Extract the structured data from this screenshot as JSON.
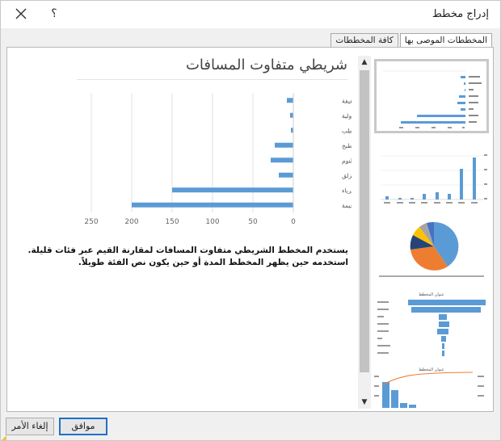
{
  "window": {
    "title": "إدراج مخطط",
    "help_label": "؟",
    "close_label": "✕"
  },
  "tabs": [
    {
      "label": "المخططات الموصى بها",
      "active": true
    },
    {
      "label": "كافة المخططات",
      "active": false
    }
  ],
  "preview": {
    "title": "شريطي متفاوت المسافات",
    "description": "يستخدم المخطط الشريطي متفاوت المسافات لمقارنة القيم عبر فئات قليلة. استخدمه حين يظهر المخطط المدة أو حين يكون نص الفئة طويلاً."
  },
  "chart_data": {
    "type": "bar",
    "orientation": "horizontal",
    "x_reversed": true,
    "categories": [
      "وحدات خفيفة",
      "عدة إسعافات أولية",
      "حطب",
      "معدات طبخ",
      "حقائب للنوم",
      "الزلق",
      "مولد كهرباء",
      "الخيمة"
    ],
    "values": [
      8,
      4,
      3,
      23,
      28,
      18,
      150,
      200
    ],
    "xlim": [
      0,
      250
    ],
    "xticks": [
      0,
      50,
      100,
      150,
      200,
      250
    ],
    "grid": true,
    "color": "#5b9bd5"
  },
  "thumbnails": [
    {
      "kind": "clustered-bar",
      "selected": true
    },
    {
      "kind": "clustered-column",
      "selected": false
    },
    {
      "kind": "pie",
      "selected": false
    },
    {
      "kind": "funnel",
      "selected": false,
      "title": "عنوان المخطط"
    },
    {
      "kind": "pareto",
      "selected": false,
      "title": "عنوان المخطط"
    }
  ],
  "buttons": {
    "ok": "موافق",
    "cancel": "إلغاء الأمر"
  },
  "colors": {
    "accent": "#1e70c8",
    "bar": "#5b9bd5",
    "orange": "#ed7d31",
    "gray": "#a5a5a5",
    "yellow": "#ffc000",
    "darkblue": "#264478"
  },
  "scrollbar": {
    "up_arrow": "▲",
    "down_arrow": "▼"
  }
}
